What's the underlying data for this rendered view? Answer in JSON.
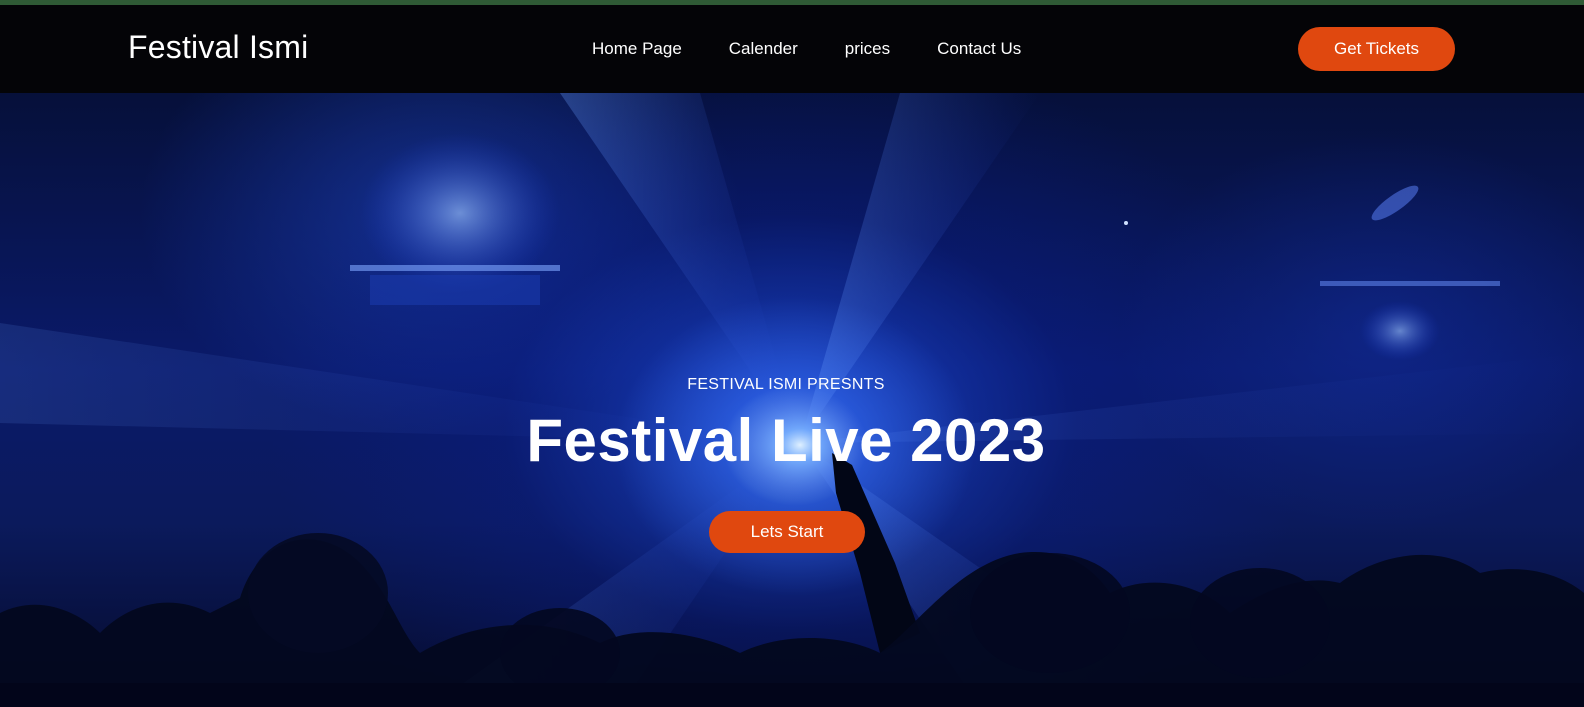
{
  "colors": {
    "accent": "#e0480f",
    "nav_background": "#040407",
    "hero_blue": "#0a1a6a",
    "text": "#ffffff"
  },
  "header": {
    "brand": "Festival Ismi",
    "nav": [
      {
        "label": "Home Page"
      },
      {
        "label": "Calender"
      },
      {
        "label": "prices"
      },
      {
        "label": "Contact Us"
      }
    ],
    "cta_label": "Get Tickets"
  },
  "hero": {
    "background": "concert-crowd-blue-light-image",
    "eyebrow": "FESTIVAL ISMI PRESNTS",
    "title": "Festival Live 2023",
    "cta_label": "Lets Start"
  }
}
